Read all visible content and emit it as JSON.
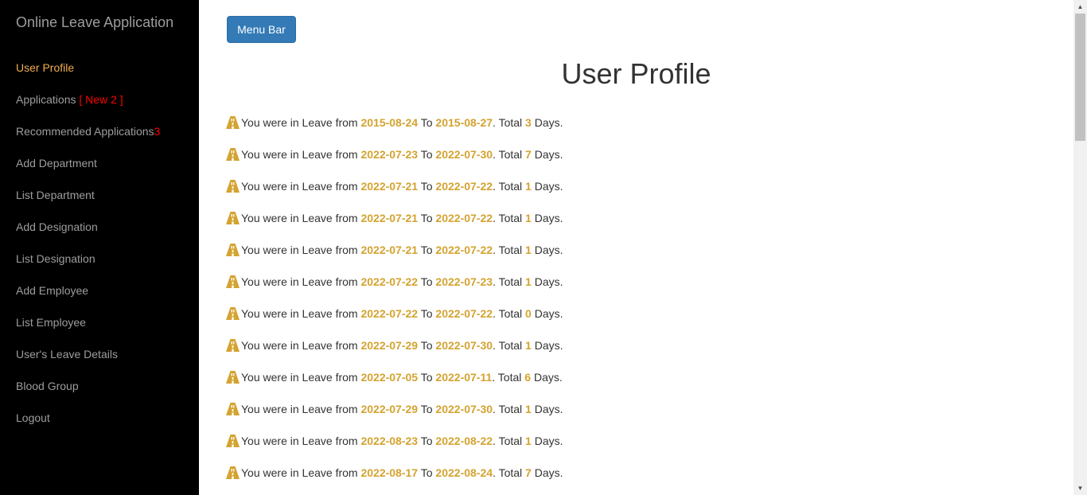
{
  "sidebar": {
    "brand": "Online Leave Application",
    "items": [
      {
        "label": "User Profile",
        "active": true
      },
      {
        "label": "Applications",
        "badge": "[ New 2 ]"
      },
      {
        "label": "Recommended Applications",
        "badge": "3"
      },
      {
        "label": "Add Department"
      },
      {
        "label": "List Department"
      },
      {
        "label": "Add Designation"
      },
      {
        "label": "List Designation"
      },
      {
        "label": "Add Employee"
      },
      {
        "label": "List Employee"
      },
      {
        "label": "User's Leave Details"
      },
      {
        "label": "Blood Group"
      },
      {
        "label": "Logout"
      }
    ]
  },
  "main": {
    "menu_button": "Menu Bar",
    "title": "User Profile",
    "text": {
      "prefix": "You were in Leave from",
      "to": "To",
      "total": ". Total",
      "days": "Days."
    },
    "leaves": [
      {
        "from": "2015-08-24",
        "to": "2015-08-27",
        "total": "3"
      },
      {
        "from": "2022-07-23",
        "to": "2022-07-30",
        "total": "7"
      },
      {
        "from": "2022-07-21",
        "to": "2022-07-22",
        "total": "1"
      },
      {
        "from": "2022-07-21",
        "to": "2022-07-22",
        "total": "1"
      },
      {
        "from": "2022-07-21",
        "to": "2022-07-22",
        "total": "1"
      },
      {
        "from": "2022-07-22",
        "to": "2022-07-23",
        "total": "1"
      },
      {
        "from": "2022-07-22",
        "to": "2022-07-22",
        "total": "0"
      },
      {
        "from": "2022-07-29",
        "to": "2022-07-30",
        "total": "1"
      },
      {
        "from": "2022-07-05",
        "to": "2022-07-11",
        "total": "6"
      },
      {
        "from": "2022-07-29",
        "to": "2022-07-30",
        "total": "1"
      },
      {
        "from": "2022-08-23",
        "to": "2022-08-22",
        "total": "1"
      },
      {
        "from": "2022-08-17",
        "to": "2022-08-24",
        "total": "7"
      }
    ]
  },
  "icons": {
    "leave_row": "road-warning-icon"
  },
  "colors": {
    "sidebar_bg": "#000000",
    "sidebar_text": "#9d9d9d",
    "active": "#f0ad4e",
    "badge": "#ff0000",
    "highlight": "#d4a330",
    "button": "#337ab7"
  }
}
